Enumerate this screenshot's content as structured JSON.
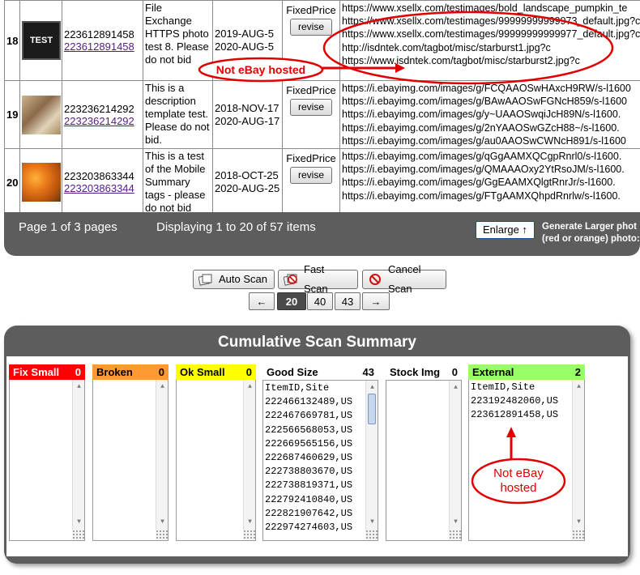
{
  "rows": [
    {
      "num": "18",
      "thumb_text": "TEST",
      "item_id": "223612891458",
      "item_link": "223612891458",
      "title": "File Exchange HTTPS photo test 8. Please do not bid",
      "start": "2019-AUG-5",
      "end": "2020-AUG-5",
      "format": "FixedPrice",
      "revise": "revise",
      "urls": [
        "https://www.xsellx.com/testimages/bold_landscape_pumpkin_te",
        "https://www.xsellx.com/testimages/99999999999973_default.jpg?c",
        "https://www.xsellx.com/testimages/99999999999977_default.jpg?c",
        "http://isdntek.com/tagbot/misc/starburst1.jpg?c",
        "https://www.isdntek.com/tagbot/misc/starburst2.jpg?c"
      ]
    },
    {
      "num": "19",
      "item_id": "223236214292",
      "item_link": "223236214292",
      "title": "This is a description template test. Please do not bid.",
      "start": "2018-NOV-17",
      "end": "2020-AUG-17",
      "format": "FixedPrice",
      "revise": "revise",
      "urls": [
        "https://i.ebayimg.com/images/g/FCQAAOSwHAxcH9RW/s-l1600",
        "https://i.ebayimg.com/images/g/BAwAAOSwFGNcH859/s-l1600",
        "https://i.ebayimg.com/images/g/y~UAAOSwqiJcH89N/s-l1600.",
        "https://i.ebayimg.com/images/g/2nYAAOSwGZcH88~/s-l1600.",
        "https://i.ebayimg.com/images/g/au0AAOSwCWNcH891/s-l1600"
      ]
    },
    {
      "num": "20",
      "item_id": "223203863344",
      "item_link": "223203863344",
      "title": "This is a test of the Mobile Summary tags - please do not bid",
      "start": "2018-OCT-25",
      "end": "2020-AUG-25",
      "format": "FixedPrice",
      "revise": "revise",
      "urls": [
        "https://i.ebayimg.com/images/g/qGgAAMXQCgpRnrl0/s-l1600.",
        "https://i.ebayimg.com/images/g/QMAAAOxy2YtRsoJM/s-l1600.",
        "https://i.ebayimg.com/images/g/GgEAAMXQlgtRnrJr/s-l1600.",
        "https://i.ebayimg.com/images/g/FTgAAMXQhpdRnrlw/s-l1600."
      ]
    }
  ],
  "pager": {
    "pages": "Page 1 of 3 pages",
    "display": "Displaying 1 to 20 of 57 items",
    "enlarge": "Enlarge ↑",
    "note_line1": "Generate Larger phot",
    "note_line2": "(red or orange) photo:"
  },
  "scan_buttons": {
    "auto": "Auto Scan",
    "fast": "Fast Scan",
    "cancel": "Cancel Scan"
  },
  "page_size": {
    "prev": "←",
    "opt20": "20",
    "opt40": "40",
    "opt43": "43",
    "next": "→",
    "selected": "20"
  },
  "summary": {
    "title": "Cumulative Scan Summary",
    "columns": [
      {
        "label": "Fix Small",
        "count": "0",
        "color": "#ff0000",
        "text_color": "#ffffff",
        "lines": []
      },
      {
        "label": "Broken",
        "count": "0",
        "color": "#ff9933",
        "text_color": "#000000",
        "lines": []
      },
      {
        "label": "Ok Small",
        "count": "0",
        "color": "#ffff00",
        "text_color": "#000000",
        "lines": []
      },
      {
        "label": "Good Size",
        "count": "43",
        "color": "#ffffff",
        "text_color": "#000000",
        "lines": [
          "ItemID,Site",
          "222466132489,US",
          "222467669781,US",
          "222566568053,US",
          "222669565156,US",
          "222687460629,US",
          "222738803670,US",
          "222738819371,US",
          "222792410840,US",
          "222821907642,US",
          "222974274603,US"
        ]
      },
      {
        "label": "Stock Img",
        "count": "0",
        "color": "#ffffff",
        "text_color": "#000000",
        "lines": []
      },
      {
        "label": "External",
        "count": "2",
        "color": "#99ff66",
        "text_color": "#000000",
        "lines": [
          "ItemID,Site",
          "223192482060,US",
          "223612891458,US"
        ]
      }
    ]
  },
  "annotations": {
    "top": "Not eBay hosted",
    "bottom_line1": "Not eBay",
    "bottom_line2": "hosted",
    "color": "#e00000"
  }
}
